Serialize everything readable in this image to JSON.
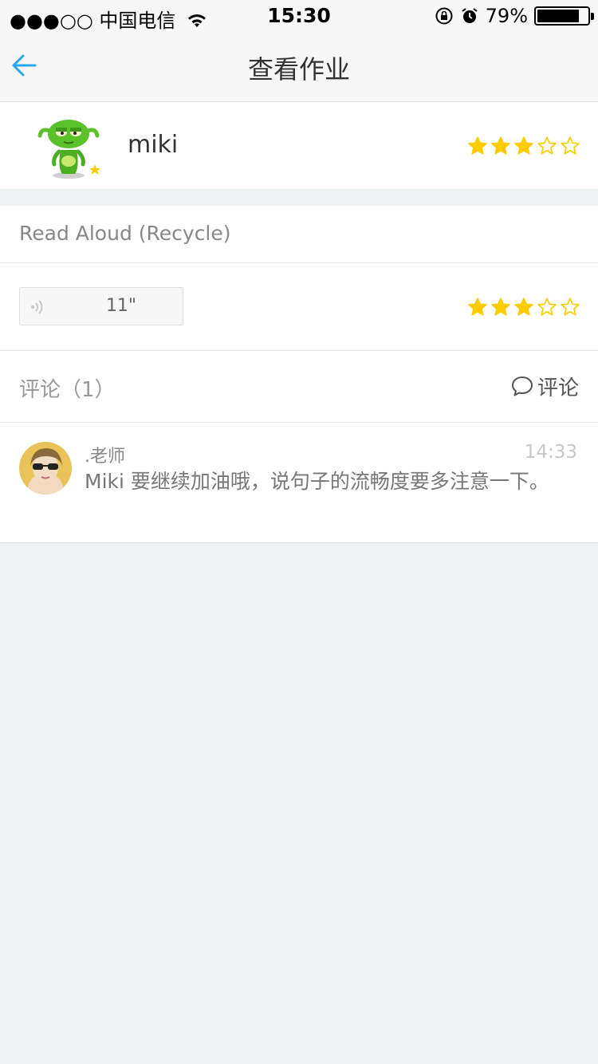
{
  "status_bar": {
    "signal_dots": "●●●○○",
    "carrier": "中国电信",
    "time": "15:30",
    "battery_percent": "79%",
    "battery_level": 0.79,
    "icons": [
      "wifi-icon",
      "orientation-lock-icon",
      "alarm-icon",
      "battery-icon"
    ]
  },
  "nav": {
    "title": "查看作业",
    "back_icon": "back-arrow-icon"
  },
  "student": {
    "name": "miki",
    "rating": 3,
    "rating_max": 5
  },
  "homework": {
    "title": "Read Aloud (Recycle)",
    "audio_duration": "11\"",
    "rating": 3,
    "rating_max": 5
  },
  "comments": {
    "header": "评论（1）",
    "action_label": "评论",
    "items": [
      {
        "author": ".老师",
        "time": "14:33",
        "text": "Miki  要继续加油哦，说句子的流畅度要多注意一下。"
      }
    ]
  },
  "colors": {
    "accent": "#2aa7e9",
    "star": "#ffcc00",
    "background": "#eff3f4"
  }
}
